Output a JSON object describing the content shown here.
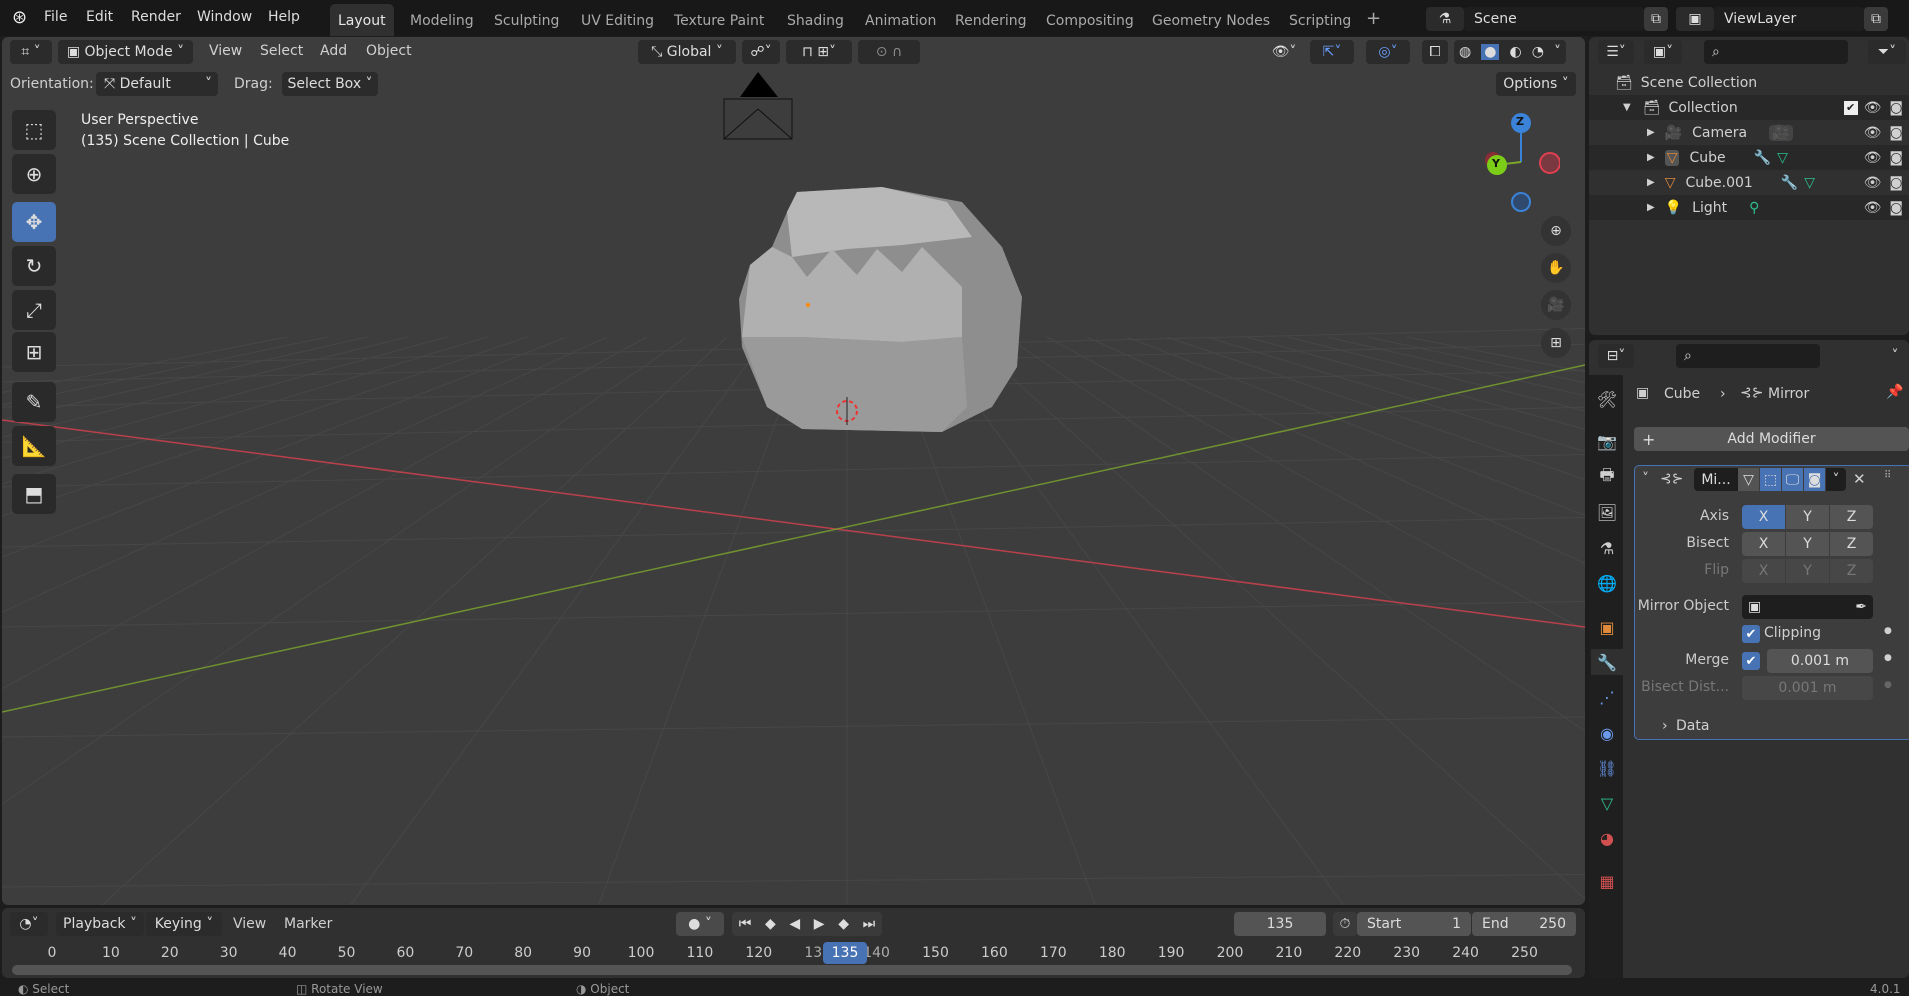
{
  "topbar": {
    "menus": [
      "File",
      "Edit",
      "Render",
      "Window",
      "Help"
    ],
    "workspaces": [
      "Layout",
      "Modeling",
      "Sculpting",
      "UV Editing",
      "Texture Paint",
      "Shading",
      "Animation",
      "Rendering",
      "Compositing",
      "Geometry Nodes",
      "Scripting"
    ],
    "active_workspace": "Layout",
    "scene": "Scene",
    "view_layer": "ViewLayer"
  },
  "viewport": {
    "mode": "Object Mode",
    "menus": [
      "View",
      "Select",
      "Add",
      "Object"
    ],
    "transform_orientation": "Global",
    "orientation_label": "Orientation:",
    "orientation_value": "Default",
    "drag_label": "Drag:",
    "drag_value": "Select Box",
    "options": "Options",
    "overlay_title": "User Perspective",
    "overlay_subtitle": "(135) Scene Collection | Cube",
    "gizmo": {
      "z": "Z",
      "y": "Y"
    },
    "axis_colors": {
      "x": "#d8414f",
      "y": "#7ca72c",
      "z": "#3b83d8"
    }
  },
  "outliner": {
    "root": "Scene Collection",
    "collection": "Collection",
    "items": [
      {
        "name": "Camera",
        "icon": "camera-icon"
      },
      {
        "name": "Cube",
        "icon": "mesh-icon"
      },
      {
        "name": "Cube.001",
        "icon": "mesh-icon"
      },
      {
        "name": "Light",
        "icon": "light-icon"
      }
    ]
  },
  "properties": {
    "breadcrumb_object": "Cube",
    "breadcrumb_modifier": "Mirror",
    "add_modifier": "Add Modifier",
    "modifier_name": "Mi...",
    "axis_label": "Axis",
    "bisect_label": "Bisect",
    "flip_label": "Flip",
    "axes": [
      "X",
      "Y",
      "Z"
    ],
    "mirror_object_label": "Mirror Object",
    "clipping_label": "Clipping",
    "clipping": true,
    "merge_label": "Merge",
    "merge": true,
    "merge_value": "0.001 m",
    "bisect_dist_label": "Bisect Dist...",
    "bisect_dist_value": "0.001 m",
    "data_label": "Data"
  },
  "timeline": {
    "menus": [
      "Playback",
      "Keying",
      "View",
      "Marker"
    ],
    "current_frame": "135",
    "start_label": "Start",
    "start": "1",
    "end_label": "End",
    "end": "250",
    "ticks": [
      "0",
      "10",
      "20",
      "30",
      "40",
      "50",
      "60",
      "70",
      "80",
      "90",
      "100",
      "110",
      "120",
      "130",
      "140",
      "150",
      "160",
      "170",
      "180",
      "190",
      "200",
      "210",
      "220",
      "230",
      "240",
      "250"
    ]
  },
  "statusbar": {
    "items": [
      "Select",
      "Rotate View",
      "Object"
    ],
    "version": "4.0.1"
  },
  "accent": "#4772b3"
}
